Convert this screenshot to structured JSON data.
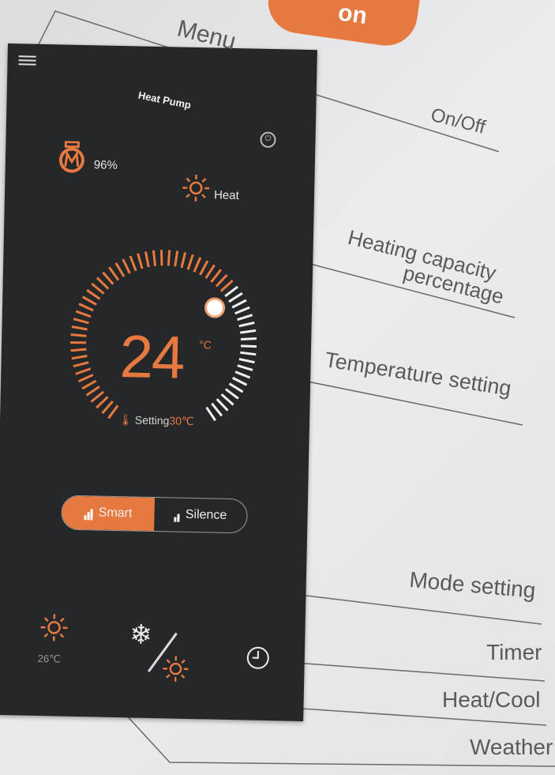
{
  "app": {
    "title": "Heat Pump"
  },
  "status": {
    "capacity": "96%",
    "mode": "Heat"
  },
  "temperature": {
    "value": "24",
    "unit": "°C",
    "setting_label": "Setting",
    "setting_value": "30℃"
  },
  "modes": [
    {
      "label": "Smart",
      "active": true
    },
    {
      "label": "Silence",
      "active": false
    }
  ],
  "weather": {
    "temp": "26℃"
  },
  "annotations": {
    "menu": "Menu",
    "onoff": "On/Off",
    "capacity_line1": "Heating capacity",
    "capacity_line2": "percentage",
    "temp_setting": "Temperature setting",
    "mode_setting": "Mode setting",
    "timer": "Timer",
    "heatcool": "Heat/Cool",
    "weather": "Weather"
  },
  "colors": {
    "accent": "#e6793f",
    "screen": "#262728"
  },
  "icons": [
    "menu-icon",
    "power-icon",
    "capacity-icon",
    "sun-icon",
    "thermometer-icon",
    "snowflake-icon",
    "timer-icon"
  ]
}
